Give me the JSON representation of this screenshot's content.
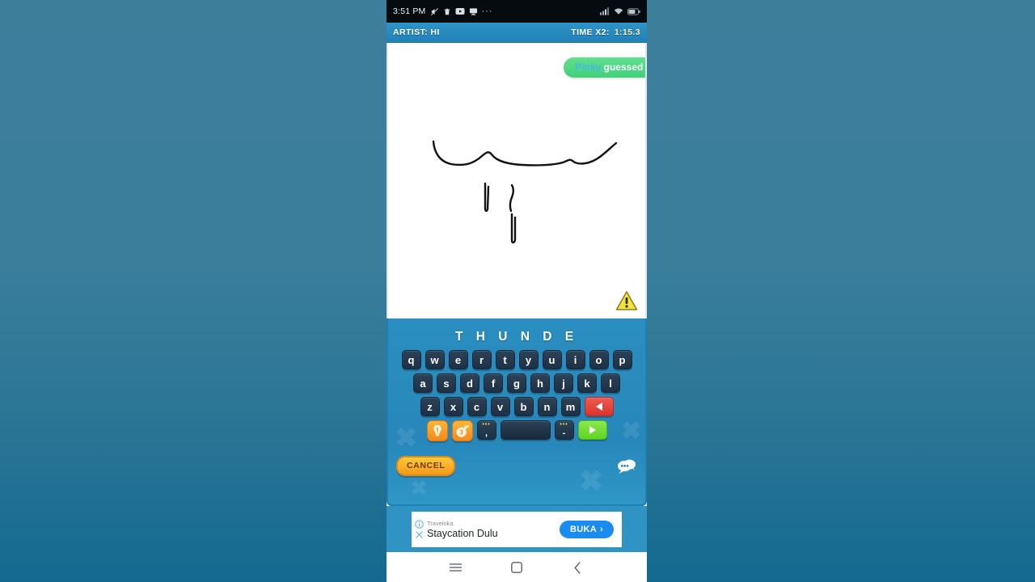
{
  "statusbar": {
    "time": "3:51 PM",
    "left_icons": [
      "mute-icon",
      "trash-icon",
      "youtube-icon",
      "cast-icon"
    ],
    "overflow": "···",
    "right_icons": [
      "signal-icon",
      "wifi-icon",
      "battery-icon"
    ]
  },
  "gamebar": {
    "artist_label": "ARTIST:",
    "artist_name": "HI",
    "time_label": "TIME X2:",
    "time_value": "1:15.3"
  },
  "canvas": {
    "toast_user": "Pinky",
    "toast_message": "guessed it",
    "report_icon": "warning-triangle-icon"
  },
  "keyboard": {
    "word_display": "T H U N D E",
    "row1": [
      "q",
      "w",
      "e",
      "r",
      "t",
      "y",
      "u",
      "i",
      "o",
      "p"
    ],
    "row2": [
      "a",
      "s",
      "d",
      "f",
      "g",
      "h",
      "j",
      "k",
      "l"
    ],
    "row3": [
      "z",
      "x",
      "c",
      "v",
      "b",
      "n",
      "m"
    ],
    "backspace_icon": "backspace-arrow-icon",
    "hint_bulb_icon": "lightbulb-hint-icon",
    "bomb_icon": "bomb-icon",
    "bomb_count": "3",
    "comma_key": ",",
    "hyphen_key": "-",
    "punct_dots": "•••",
    "space_key": "",
    "submit_icon": "play-submit-icon",
    "cancel_label": "CANCEL",
    "chat_icon": "chat-bubble-icon"
  },
  "ad": {
    "brand": "Traveloka",
    "headline": "Staycation Dulu",
    "cta_label": "BUKA",
    "cta_chevron": "›",
    "info_icon": "ad-info-icon",
    "close_icon": "ad-close-icon"
  },
  "navbar": {
    "recents_icon": "recents-menu-icon",
    "home_icon": "home-square-icon",
    "back_icon": "back-chevron-icon"
  },
  "colors": {
    "accent_blue": "#2a8ec0",
    "toast_green": "#4ed184",
    "submit_green": "#6fdc2a",
    "backspace_red": "#e0392f",
    "cancel_orange": "#f5a81c",
    "ad_blue": "#1a8cf0"
  }
}
